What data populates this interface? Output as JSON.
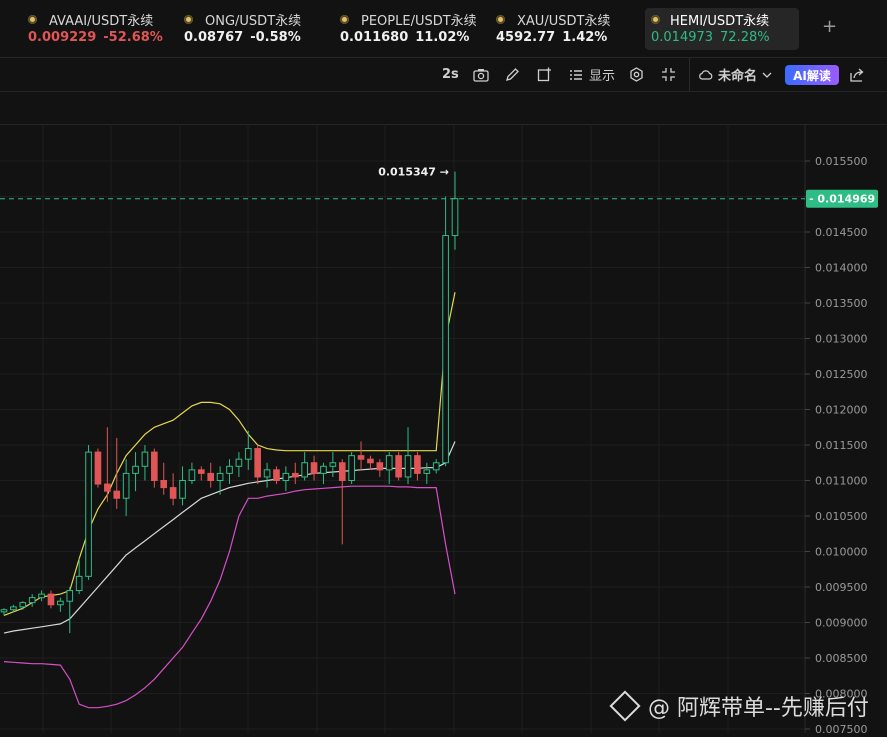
{
  "tabs": [
    {
      "symbol": "AVAAI/USDT永续",
      "price": "0.009229",
      "change": "-52.68%",
      "price_color": "red",
      "change_color": "red"
    },
    {
      "symbol": "ONG/USDT永续",
      "price": "0.08767",
      "change": "-0.58%",
      "price_color": "white",
      "change_color": "white"
    },
    {
      "symbol": "PEOPLE/USDT永续",
      "price": "0.011680",
      "change": "11.02%",
      "price_color": "white",
      "change_color": "white"
    },
    {
      "symbol": "XAU/USDT永续",
      "price": "4592.77",
      "change": "1.42%",
      "price_color": "white",
      "change_color": "white"
    },
    {
      "symbol": "HEMI/USDT永续",
      "price": "0.014973",
      "change": "72.28%",
      "price_color": "green",
      "change_color": "green"
    }
  ],
  "toolbar": {
    "interval": "2s",
    "display_label": "显示",
    "layout_name": "未命名",
    "ai_label": "AI解读"
  },
  "watermark": "@ 阿辉带单--先赚后付",
  "chart_data": {
    "type": "candlestick",
    "symbol": "HEMI/USDT永续",
    "current_price": "0.014969",
    "high_marker": "0.015347",
    "y_ticks": [
      "0.015500",
      "0.015000",
      "0.014500",
      "0.014000",
      "0.013500",
      "0.013000",
      "0.012500",
      "0.012000",
      "0.011500",
      "0.011000",
      "0.010500",
      "0.010000",
      "0.009500",
      "0.009000",
      "0.008500",
      "0.008000",
      "0.007500"
    ],
    "ylim": [
      0.0075,
      0.0158
    ],
    "colors": {
      "up": "#2ebd85",
      "down": "#e05656",
      "ma": "#e6d84c",
      "mid": "#d8d8d8",
      "lower": "#d64fc6"
    },
    "candles": [
      {
        "o": 0.00915,
        "h": 0.0092,
        "l": 0.0091,
        "c": 0.00918
      },
      {
        "o": 0.00918,
        "h": 0.00925,
        "l": 0.00915,
        "c": 0.00922
      },
      {
        "o": 0.00922,
        "h": 0.0093,
        "l": 0.00918,
        "c": 0.00928
      },
      {
        "o": 0.00928,
        "h": 0.0094,
        "l": 0.00922,
        "c": 0.00935
      },
      {
        "o": 0.00935,
        "h": 0.00945,
        "l": 0.0093,
        "c": 0.0094
      },
      {
        "o": 0.0094,
        "h": 0.00945,
        "l": 0.0092,
        "c": 0.00925
      },
      {
        "o": 0.00925,
        "h": 0.00935,
        "l": 0.00915,
        "c": 0.0093
      },
      {
        "o": 0.0093,
        "h": 0.0095,
        "l": 0.00885,
        "c": 0.00945
      },
      {
        "o": 0.00945,
        "h": 0.0099,
        "l": 0.0094,
        "c": 0.00965
      },
      {
        "o": 0.00965,
        "h": 0.0115,
        "l": 0.0096,
        "c": 0.0114
      },
      {
        "o": 0.0114,
        "h": 0.01145,
        "l": 0.0109,
        "c": 0.01095
      },
      {
        "o": 0.01095,
        "h": 0.01175,
        "l": 0.0107,
        "c": 0.01085
      },
      {
        "o": 0.01085,
        "h": 0.0116,
        "l": 0.0106,
        "c": 0.01075
      },
      {
        "o": 0.01075,
        "h": 0.0113,
        "l": 0.0105,
        "c": 0.0111
      },
      {
        "o": 0.0111,
        "h": 0.0114,
        "l": 0.01085,
        "c": 0.0112
      },
      {
        "o": 0.0112,
        "h": 0.0115,
        "l": 0.011,
        "c": 0.0114
      },
      {
        "o": 0.0114,
        "h": 0.01145,
        "l": 0.0109,
        "c": 0.011
      },
      {
        "o": 0.011,
        "h": 0.01125,
        "l": 0.0108,
        "c": 0.0109
      },
      {
        "o": 0.0109,
        "h": 0.0111,
        "l": 0.01065,
        "c": 0.01075
      },
      {
        "o": 0.01075,
        "h": 0.0112,
        "l": 0.01065,
        "c": 0.011
      },
      {
        "o": 0.011,
        "h": 0.01125,
        "l": 0.01095,
        "c": 0.01115
      },
      {
        "o": 0.01115,
        "h": 0.0112,
        "l": 0.011,
        "c": 0.0111
      },
      {
        "o": 0.0111,
        "h": 0.01125,
        "l": 0.0109,
        "c": 0.011
      },
      {
        "o": 0.011,
        "h": 0.0112,
        "l": 0.0108,
        "c": 0.0111
      },
      {
        "o": 0.0111,
        "h": 0.0113,
        "l": 0.01095,
        "c": 0.0112
      },
      {
        "o": 0.0112,
        "h": 0.0114,
        "l": 0.01105,
        "c": 0.0113
      },
      {
        "o": 0.0113,
        "h": 0.0117,
        "l": 0.01115,
        "c": 0.01145
      },
      {
        "o": 0.01145,
        "h": 0.0115,
        "l": 0.01095,
        "c": 0.01105
      },
      {
        "o": 0.01105,
        "h": 0.01125,
        "l": 0.0109,
        "c": 0.01115
      },
      {
        "o": 0.01115,
        "h": 0.0112,
        "l": 0.01095,
        "c": 0.011
      },
      {
        "o": 0.011,
        "h": 0.0112,
        "l": 0.01085,
        "c": 0.0111
      },
      {
        "o": 0.0111,
        "h": 0.01125,
        "l": 0.01095,
        "c": 0.01105
      },
      {
        "o": 0.01105,
        "h": 0.0114,
        "l": 0.011,
        "c": 0.01125
      },
      {
        "o": 0.01125,
        "h": 0.01135,
        "l": 0.011,
        "c": 0.0111
      },
      {
        "o": 0.0111,
        "h": 0.01125,
        "l": 0.01095,
        "c": 0.0112
      },
      {
        "o": 0.0112,
        "h": 0.0114,
        "l": 0.01105,
        "c": 0.01125
      },
      {
        "o": 0.01125,
        "h": 0.0113,
        "l": 0.0101,
        "c": 0.011
      },
      {
        "o": 0.011,
        "h": 0.0114,
        "l": 0.01095,
        "c": 0.01135
      },
      {
        "o": 0.01135,
        "h": 0.01155,
        "l": 0.01115,
        "c": 0.0113
      },
      {
        "o": 0.0113,
        "h": 0.01135,
        "l": 0.01115,
        "c": 0.01125
      },
      {
        "o": 0.01125,
        "h": 0.0113,
        "l": 0.01105,
        "c": 0.01115
      },
      {
        "o": 0.01115,
        "h": 0.0114,
        "l": 0.01095,
        "c": 0.01135
      },
      {
        "o": 0.01135,
        "h": 0.0114,
        "l": 0.011,
        "c": 0.01105
      },
      {
        "o": 0.01105,
        "h": 0.01175,
        "l": 0.01095,
        "c": 0.01135
      },
      {
        "o": 0.01135,
        "h": 0.0114,
        "l": 0.011,
        "c": 0.0111
      },
      {
        "o": 0.0111,
        "h": 0.01125,
        "l": 0.01095,
        "c": 0.01115
      },
      {
        "o": 0.01115,
        "h": 0.0113,
        "l": 0.0111,
        "c": 0.01125
      },
      {
        "o": 0.01125,
        "h": 0.015,
        "l": 0.0112,
        "c": 0.01445
      },
      {
        "o": 0.01445,
        "h": 0.01535,
        "l": 0.01425,
        "c": 0.01497
      }
    ],
    "upper_band": [
      0.0091,
      0.00915,
      0.0092,
      0.00928,
      0.00936,
      0.00938,
      0.0094,
      0.00945,
      0.0099,
      0.0103,
      0.0106,
      0.0108,
      0.0111,
      0.01135,
      0.0115,
      0.01165,
      0.01175,
      0.0118,
      0.01185,
      0.01195,
      0.01205,
      0.0121,
      0.0121,
      0.01208,
      0.012,
      0.01185,
      0.01165,
      0.0115,
      0.01145,
      0.01143,
      0.01142,
      0.01142,
      0.01142,
      0.01142,
      0.01142,
      0.01142,
      0.01142,
      0.01142,
      0.01142,
      0.01142,
      0.01142,
      0.01142,
      0.01142,
      0.01142,
      0.01142,
      0.01142,
      0.01142,
      0.013,
      0.01365
    ],
    "mid_band": [
      0.00885,
      0.00888,
      0.0089,
      0.00892,
      0.00894,
      0.00896,
      0.00898,
      0.00905,
      0.0092,
      0.00935,
      0.0095,
      0.00965,
      0.0098,
      0.00995,
      0.01005,
      0.01015,
      0.01025,
      0.01035,
      0.01045,
      0.01055,
      0.01065,
      0.01075,
      0.0108,
      0.01085,
      0.0109,
      0.01093,
      0.01096,
      0.01098,
      0.011,
      0.01102,
      0.01104,
      0.01106,
      0.01108,
      0.0111,
      0.01111,
      0.01112,
      0.01113,
      0.01114,
      0.01115,
      0.01116,
      0.01117,
      0.01117,
      0.01117,
      0.01117,
      0.01117,
      0.01118,
      0.01118,
      0.01125,
      0.01155
    ],
    "lower_band": [
      0.00845,
      0.00844,
      0.00843,
      0.00842,
      0.00842,
      0.00841,
      0.0084,
      0.0082,
      0.00785,
      0.0078,
      0.0078,
      0.00782,
      0.00785,
      0.0079,
      0.00798,
      0.00808,
      0.0082,
      0.00835,
      0.0085,
      0.00865,
      0.00885,
      0.00905,
      0.0093,
      0.0096,
      0.01,
      0.0105,
      0.01075,
      0.01075,
      0.01078,
      0.0108,
      0.01082,
      0.01085,
      0.01087,
      0.01088,
      0.01089,
      0.0109,
      0.01091,
      0.01092,
      0.01092,
      0.01092,
      0.01092,
      0.01092,
      0.01091,
      0.01091,
      0.0109,
      0.0109,
      0.0109,
      0.0101,
      0.0094
    ]
  }
}
